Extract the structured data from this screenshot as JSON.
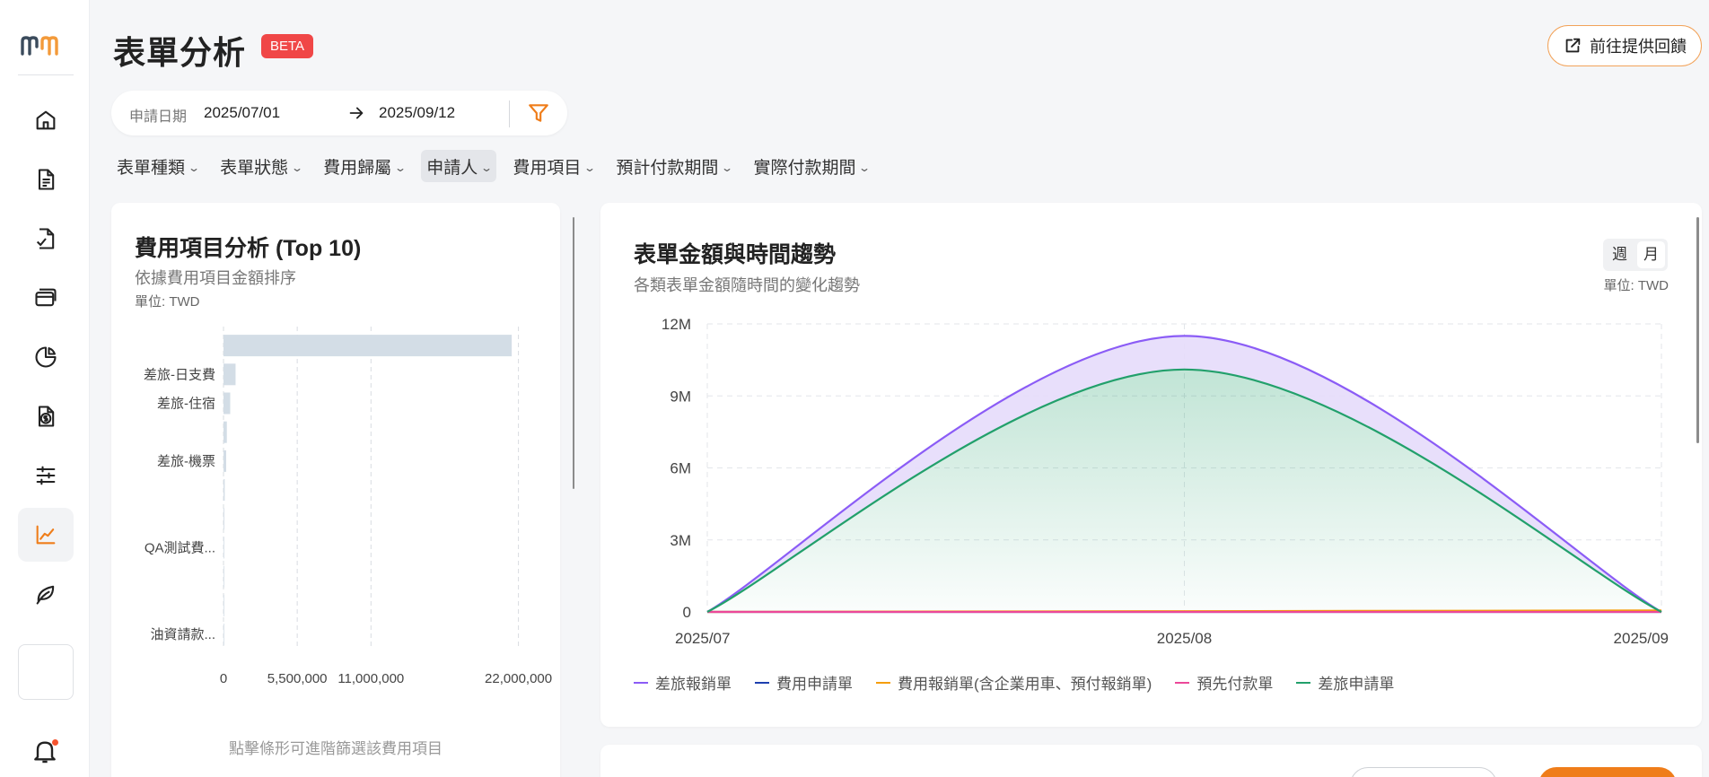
{
  "header": {
    "title": "表單分析",
    "badge": "BETA",
    "feedback_label": "前往提供回饋"
  },
  "sidebar": {
    "items": [
      {
        "icon": "home-icon"
      },
      {
        "icon": "document-icon"
      },
      {
        "icon": "document-check-icon"
      },
      {
        "icon": "credit-card-icon"
      },
      {
        "icon": "pie-chart-icon"
      },
      {
        "icon": "money-document-icon"
      },
      {
        "icon": "sliders-icon"
      },
      {
        "icon": "line-chart-icon",
        "active": true
      },
      {
        "icon": "leaf-icon"
      }
    ],
    "notification_icon": "bell-icon"
  },
  "date_filter": {
    "label": "申請日期",
    "start": "2025/07/01",
    "end": "2025/09/12"
  },
  "filters": [
    {
      "label": "表單種類"
    },
    {
      "label": "表單狀態"
    },
    {
      "label": "費用歸屬"
    },
    {
      "label": "申請人",
      "active": true
    },
    {
      "label": "費用項目"
    },
    {
      "label": "預計付款期間"
    },
    {
      "label": "實際付款期間"
    }
  ],
  "expense_card": {
    "title": "費用項目分析 (Top 10)",
    "subtitle": "依據費用項目金額排序",
    "unit": "單位: TWD",
    "hint": "點擊條形可進階篩選該費用項目"
  },
  "trend_card": {
    "title": "表單金額與時間趨勢",
    "subtitle": "各類表單金額隨時間的變化趨勢",
    "unit": "單位: TWD",
    "toggle": {
      "week": "週",
      "month": "月",
      "selected": "month"
    }
  },
  "colors": {
    "accent": "#ef7d1a",
    "beta": "#f04747",
    "bar": "#d3dde6"
  },
  "chart_data": [
    {
      "type": "bar",
      "orientation": "horizontal",
      "categories": [
        "",
        "差旅-日支費",
        "差旅-住宿",
        "",
        "差旅-機票",
        "",
        "",
        "QA測試費...",
        "",
        "",
        "油資請款..."
      ],
      "values": [
        21500000,
        900000,
        500000,
        250000,
        200000,
        90000,
        60000,
        40000,
        25000,
        15000,
        8000
      ],
      "xlim": [
        0,
        23500000
      ],
      "xticks": [
        0,
        5500000,
        11000000,
        22000000
      ],
      "xtick_labels": [
        "0",
        "5,500,000",
        "11,000,000",
        "22,000,000"
      ],
      "grid": true
    },
    {
      "type": "area",
      "x": [
        "2025/07",
        "2025/08",
        "2025/09"
      ],
      "ylim": [
        0,
        12000000
      ],
      "yticks": [
        0,
        3000000,
        6000000,
        9000000,
        12000000
      ],
      "ytick_labels": [
        "0",
        "3M",
        "6M",
        "9M",
        "12M"
      ],
      "series": [
        {
          "name": "差旅報銷單",
          "color": "#8b5cf6",
          "values": [
            0,
            11500000,
            0
          ]
        },
        {
          "name": "費用申請單",
          "color": "#1e40af",
          "values": [
            0,
            0,
            0
          ]
        },
        {
          "name": "費用報銷單(含企業用車、預付報銷單)",
          "color": "#f59e0b",
          "values": [
            0,
            30000,
            60000
          ]
        },
        {
          "name": "預先付款單",
          "color": "#ec4899",
          "values": [
            0,
            0,
            0
          ]
        },
        {
          "name": "差旅申請單",
          "color": "#22a06b",
          "values": [
            0,
            10100000,
            0
          ]
        }
      ],
      "grid": true,
      "legend": "bottom"
    }
  ]
}
